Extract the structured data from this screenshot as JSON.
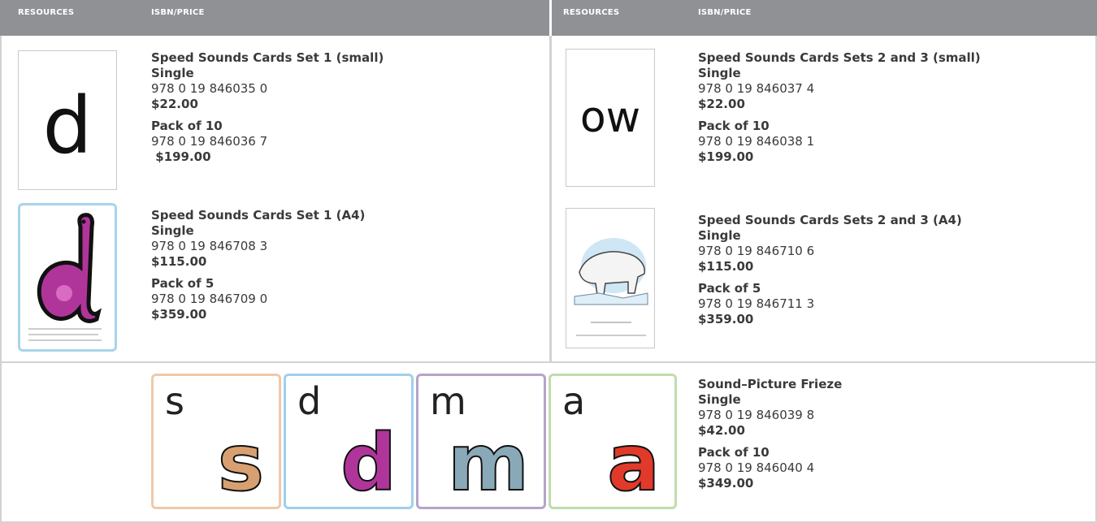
{
  "header": {
    "left": {
      "col1": "RESOURCES",
      "col2": "ISBN/PRICE"
    },
    "right": {
      "col1": "RESOURCES",
      "col2": "ISBN/PRICE"
    }
  },
  "products": {
    "p1": {
      "title": "Speed Sounds Cards Set 1 (small)",
      "thumb_letter": "d",
      "single_label": "Single",
      "single_isbn": "978 0 19 846035 0",
      "single_price": "$22.00",
      "pack_label": "Pack of 10",
      "pack_isbn": "978 0 19 846036 7",
      "pack_price": " $199.00"
    },
    "p2": {
      "title": "Speed Sounds Cards Sets 2 and 3 (small)",
      "thumb_letter": "ow",
      "single_label": "Single",
      "single_isbn": "978 0 19 846037 4",
      "single_price": "$22.00",
      "pack_label": "Pack of 10",
      "pack_isbn": "978 0 19 846038 1",
      "pack_price": "$199.00"
    },
    "p3": {
      "title": "Speed Sounds Cards Set 1 (A4)",
      "thumb_letter": "d",
      "single_label": "Single",
      "single_isbn": "978 0 19 846708 3",
      "single_price": "$115.00",
      "pack_label": "Pack of 5",
      "pack_isbn": "978 0 19 846709 0",
      "pack_price": "$359.00"
    },
    "p4": {
      "title": "Speed Sounds Cards Sets 2 and 3 (A4)",
      "single_label": "Single",
      "single_isbn": "978 0 19 846710 6",
      "single_price": "$115.00",
      "pack_label": "Pack of 5",
      "pack_isbn": "978 0 19 846711 3",
      "pack_price": "$359.00"
    },
    "p5": {
      "title": "Sound–Picture Frieze",
      "single_label": "Single",
      "single_isbn": "978 0 19 846039 8",
      "single_price": "$42.00",
      "pack_label": "Pack of 10",
      "pack_isbn": "978 0 19 846040 4",
      "pack_price": "$349.00"
    }
  },
  "frieze": [
    {
      "letter": "s",
      "border": "#f0c9a8",
      "fill": "#d8a070"
    },
    {
      "letter": "d",
      "border": "#9fd0ec",
      "fill": "#b0359a"
    },
    {
      "letter": "m",
      "border": "#b6a3c9",
      "fill": "#8aa9b8"
    },
    {
      "letter": "a",
      "border": "#bfdcab",
      "fill": "#e23a2a"
    }
  ],
  "colors": {
    "header_bg": "#8f9194",
    "rule": "#d2d2d2",
    "text": "#3a3a3a"
  }
}
